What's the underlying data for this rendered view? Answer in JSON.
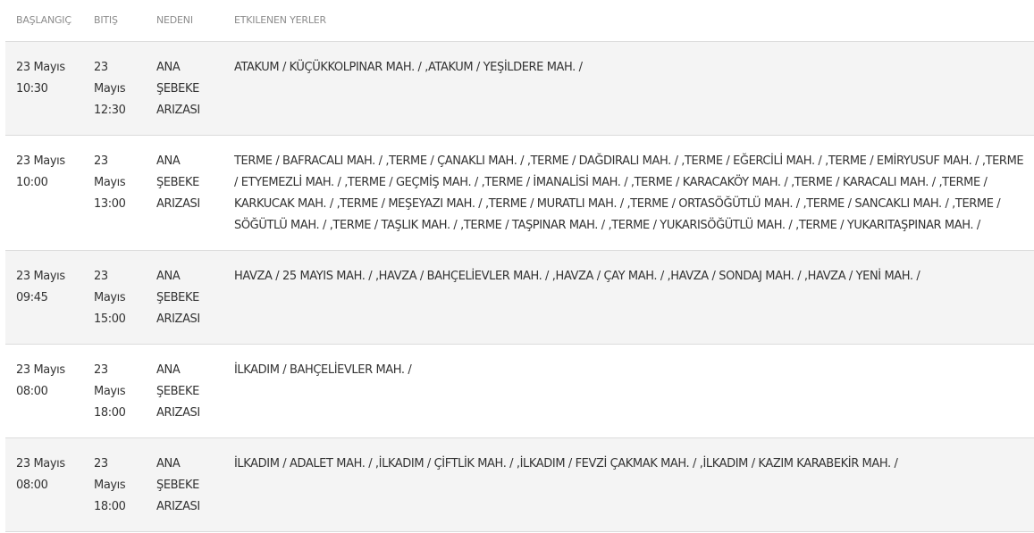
{
  "table": {
    "headers": {
      "start": "BAŞLANGIÇ",
      "end": "BITIŞ",
      "reason": "NEDENI",
      "places": "ETKILENEN YERLER"
    },
    "rows": [
      {
        "start": "23 Mayıs 10:30",
        "end": "23 Mayıs 12:30",
        "reason": "ANA ŞEBEKE ARIZASI",
        "places": "ATAKUM / KÜÇÜKKOLPINAR MAH. / ,ATAKUM / YEŞİLDERE MAH. /"
      },
      {
        "start": "23 Mayıs 10:00",
        "end": "23 Mayıs 13:00",
        "reason": "ANA ŞEBEKE ARIZASI",
        "places": "TERME / BAFRACALI MAH. / ,TERME / ÇANAKLI MAH. / ,TERME / DAĞDIRALI MAH. / ,TERME / EĞERCİLİ MAH. / ,TERME / EMİRYUSUF MAH. / ,TERME / ETYEMEZLİ MAH. / ,TERME / GEÇMİŞ MAH. / ,TERME / İMANALİSİ MAH. / ,TERME / KARACAKÖY MAH. / ,TERME / KARACALI MAH. / ,TERME / KARKUCAK MAH. / ,TERME / MEŞEYAZI MAH. / ,TERME / MURATLI MAH. / ,TERME / ORTASÖĞÜTLÜ MAH. / ,TERME / SANCAKLI MAH. / ,TERME / SÖĞÜTLÜ MAH. / ,TERME / TAŞLIK MAH. / ,TERME / TAŞPINAR MAH. / ,TERME / YUKARISÖĞÜTLÜ MAH. / ,TERME / YUKARITAŞPINAR MAH. /"
      },
      {
        "start": "23 Mayıs 09:45",
        "end": "23 Mayıs 15:00",
        "reason": "ANA ŞEBEKE ARIZASI",
        "places": "HAVZA / 25 MAYIS MAH. / ,HAVZA / BAHÇELİEVLER MAH. / ,HAVZA / ÇAY MAH. / ,HAVZA / SONDAJ MAH. / ,HAVZA / YENİ MAH. /"
      },
      {
        "start": "23 Mayıs 08:00",
        "end": "23 Mayıs 18:00",
        "reason": "ANA ŞEBEKE ARIZASI",
        "places": "İLKADIM / BAHÇELİEVLER MAH. /"
      },
      {
        "start": "23 Mayıs 08:00",
        "end": "23 Mayıs 18:00",
        "reason": "ANA ŞEBEKE ARIZASI",
        "places": "İLKADIM / ADALET MAH. / ,İLKADIM / ÇİFTLİK MAH. / ,İLKADIM / FEVZİ ÇAKMAK MAH. / ,İLKADIM / KAZIM KARABEKİR MAH. /"
      }
    ]
  }
}
